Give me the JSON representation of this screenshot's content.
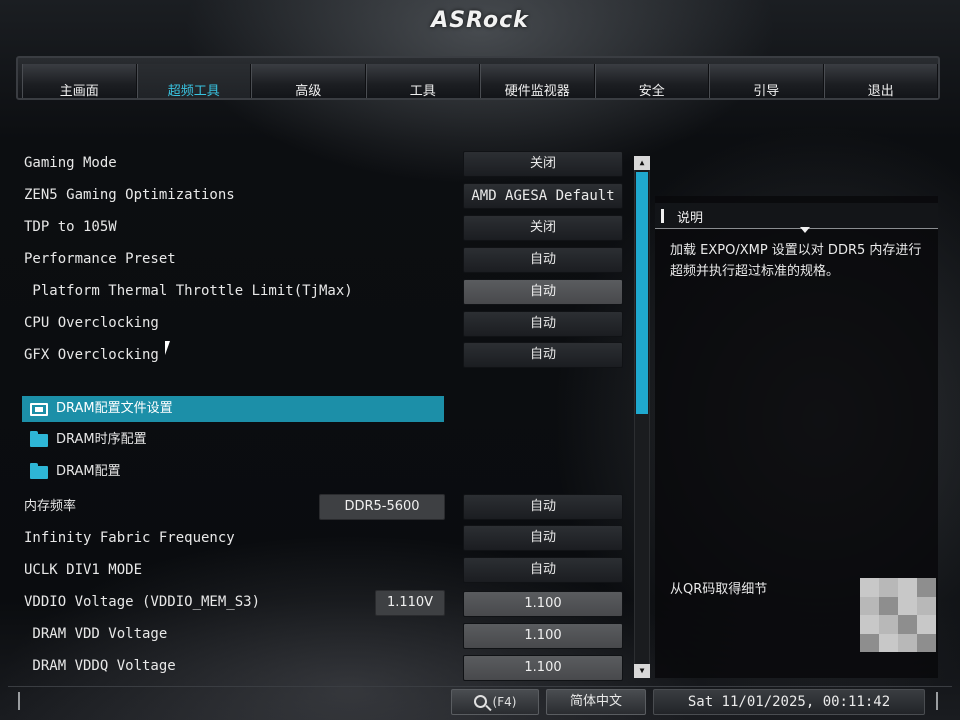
{
  "brand": "ASRock",
  "tabs": [
    "主画面",
    "超频工具",
    "高级",
    "工具",
    "硬件监视器",
    "安全",
    "引导",
    "退出"
  ],
  "active_tab": "超频工具",
  "settings": [
    {
      "label": "Gaming Mode",
      "value": "关闭"
    },
    {
      "label": "ZEN5 Gaming Optimizations",
      "value": "AMD AGESA Default"
    },
    {
      "label": "TDP to 105W",
      "value": "关闭"
    },
    {
      "label": "Performance Preset",
      "value": "自动"
    },
    {
      "label": " Platform Thermal Throttle Limit(TjMax)",
      "value": "自动"
    },
    {
      "label": "CPU Overclocking",
      "value": "自动"
    },
    {
      "label": "GFX Overclocking",
      "value": "自动"
    }
  ],
  "folders": [
    {
      "label": "DRAM配置文件设置",
      "selected": true,
      "icon": "monitor-icon"
    },
    {
      "label": "DRAM时序配置",
      "selected": false,
      "icon": "folder-icon"
    },
    {
      "label": "DRAM配置",
      "selected": false,
      "icon": "folder-icon"
    }
  ],
  "memory_settings": [
    {
      "label": "内存频率",
      "info": "DDR5-5600",
      "value": "自动"
    },
    {
      "label": "Infinity Fabric Frequency",
      "value": "自动"
    },
    {
      "label": "UCLK DIV1 MODE",
      "value": "自动"
    },
    {
      "label": "VDDIO Voltage (VDDIO_MEM_S3)",
      "info": "1.110V",
      "value": "1.100"
    },
    {
      "label": " DRAM VDD Voltage",
      "value": "1.100"
    },
    {
      "label": " DRAM VDDQ Voltage",
      "value": "1.100"
    }
  ],
  "description": {
    "title": "说明",
    "text": "加载 EXPO/XMP 设置以对 DDR5 内存进行超频并执行超过标准的规格。",
    "qr_label": "从QR码取得细节"
  },
  "footer": {
    "search_label": "(F4)",
    "language": "简体中文",
    "datetime": "Sat 11/01/2025, 00:11:42"
  },
  "colors": {
    "accent": "#1fa9cf",
    "selected_row": "#1c8fa8",
    "active_tab_text": "#39c3e0"
  }
}
